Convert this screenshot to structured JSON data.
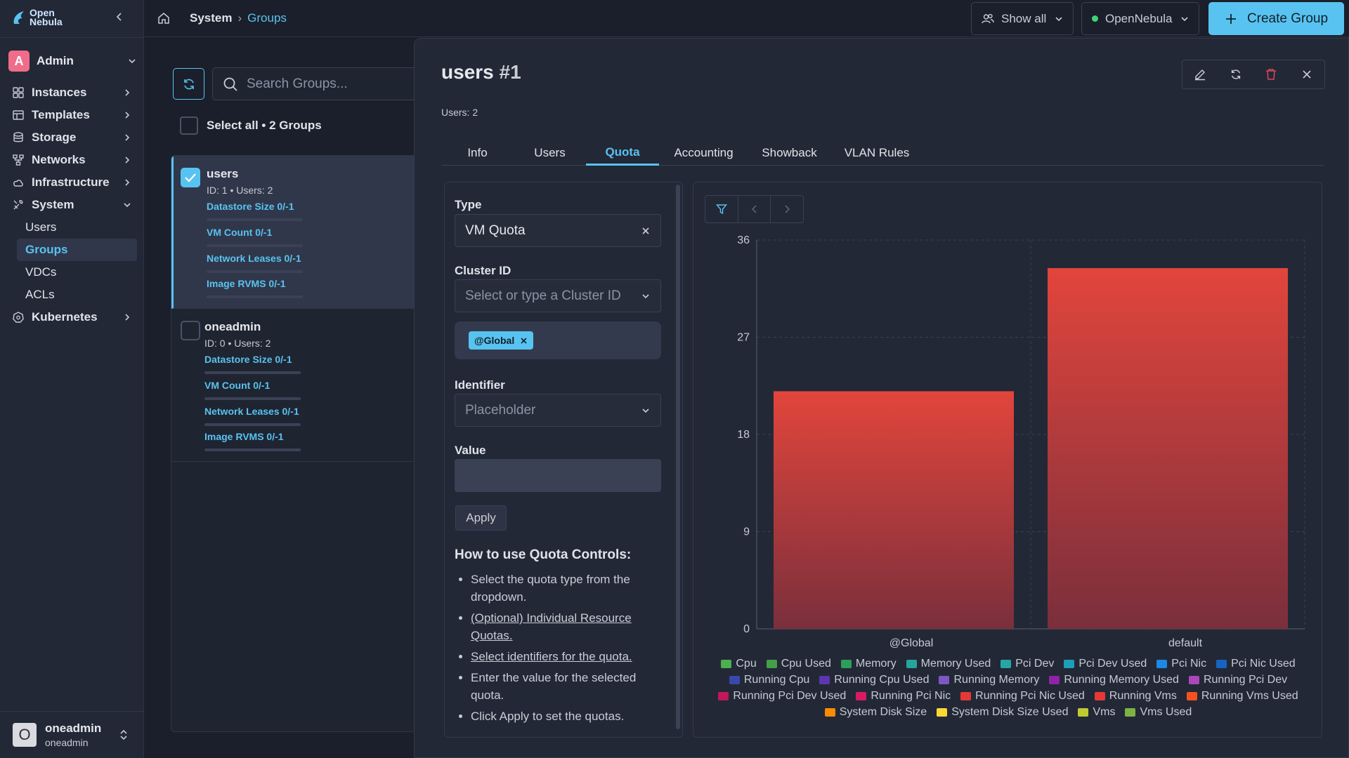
{
  "app": {
    "logo_line1": "Open",
    "logo_line2": "Nebula"
  },
  "sidebar": {
    "account": {
      "letter": "A",
      "name": "Admin"
    },
    "nav": [
      {
        "label": "Instances",
        "icon": "grid-icon"
      },
      {
        "label": "Templates",
        "icon": "template-icon"
      },
      {
        "label": "Storage",
        "icon": "database-icon"
      },
      {
        "label": "Networks",
        "icon": "network-icon"
      },
      {
        "label": "Infrastructure",
        "icon": "cloud-icon"
      },
      {
        "label": "System",
        "icon": "tools-icon"
      }
    ],
    "system_sub": [
      "Users",
      "Groups",
      "VDCs",
      "ACLs"
    ],
    "kubernetes": "Kubernetes",
    "footer": {
      "initial": "O",
      "username": "oneadmin",
      "group": "oneadmin"
    }
  },
  "topbar": {
    "breadcrumb": [
      "System",
      "Groups"
    ],
    "filter": "Show all",
    "zone": "OpenNebula",
    "create": "Create Group"
  },
  "list": {
    "search_placeholder": "Search Groups...",
    "select_all": "Select all • 2 Groups",
    "groups": [
      {
        "name": "users",
        "meta": "ID: 1 • Users: 2",
        "selected": true,
        "quotas": [
          "Datastore Size 0/-1",
          "VM Count 0/-1",
          "Network Leases 0/-1",
          "Image RVMS 0/-1"
        ]
      },
      {
        "name": "oneadmin",
        "meta": "ID: 0 • Users: 2",
        "selected": false,
        "quotas": [
          "Datastore Size 0/-1",
          "VM Count 0/-1",
          "Network Leases 0/-1",
          "Image RVMS 0/-1"
        ]
      }
    ]
  },
  "detail": {
    "name": "users",
    "id": "#1",
    "users_line": "Users: 2",
    "tabs": [
      "Info",
      "Users",
      "Quota",
      "Accounting",
      "Showback",
      "VLAN Rules"
    ],
    "active_tab": "Quota",
    "form": {
      "type_label": "Type",
      "type_value": "VM Quota",
      "cluster_label": "Cluster ID",
      "cluster_placeholder": "Select or type a Cluster ID",
      "chip": "@Global",
      "identifier_label": "Identifier",
      "identifier_placeholder": "Placeholder",
      "value_label": "Value",
      "value": "",
      "apply": "Apply",
      "howto_title": "How to use Quota Controls:",
      "steps": [
        "Select the quota type from the dropdown.",
        "(Optional) Individual Resource Quotas.",
        "Select identifiers for the quota.",
        "Enter the value for the selected quota.",
        "Click Apply to set the quotas."
      ]
    }
  },
  "chart_data": {
    "type": "bar",
    "categories": [
      "@Global",
      "default"
    ],
    "values": [
      22,
      33.4
    ],
    "ylim": [
      0,
      36
    ],
    "yticks": [
      0,
      9,
      18,
      27,
      36
    ],
    "bar_color_top": "#e2453c",
    "bar_color_bottom": "#7a2f3c",
    "grid": true,
    "legend_position": "bottom",
    "legend": [
      {
        "name": "Cpu",
        "color": "#4caf50"
      },
      {
        "name": "Cpu Used",
        "color": "#43a047"
      },
      {
        "name": "Memory",
        "color": "#2e9e5b"
      },
      {
        "name": "Memory Used",
        "color": "#26a69a"
      },
      {
        "name": "Pci Dev",
        "color": "#26a6a6"
      },
      {
        "name": "Pci Dev Used",
        "color": "#1e9fb8"
      },
      {
        "name": "Pci Nic",
        "color": "#1e88e5"
      },
      {
        "name": "Pci Nic Used",
        "color": "#1565c0"
      },
      {
        "name": "Running Cpu",
        "color": "#3949ab"
      },
      {
        "name": "Running Cpu Used",
        "color": "#5e35b1"
      },
      {
        "name": "Running Memory",
        "color": "#7e57c2"
      },
      {
        "name": "Running Memory Used",
        "color": "#8e24aa"
      },
      {
        "name": "Running Pci Dev",
        "color": "#ab47bc"
      },
      {
        "name": "Running Pci Dev Used",
        "color": "#c2185b"
      },
      {
        "name": "Running Pci Nic",
        "color": "#d81b60"
      },
      {
        "name": "Running Pci Nic Used",
        "color": "#e53935"
      },
      {
        "name": "Running Vms",
        "color": "#e53935"
      },
      {
        "name": "Running Vms Used",
        "color": "#f4511e"
      },
      {
        "name": "System Disk Size",
        "color": "#fb8c00"
      },
      {
        "name": "System Disk Size Used",
        "color": "#fdd835"
      },
      {
        "name": "Vms",
        "color": "#c0ca33"
      },
      {
        "name": "Vms Used",
        "color": "#7cb342"
      }
    ]
  }
}
